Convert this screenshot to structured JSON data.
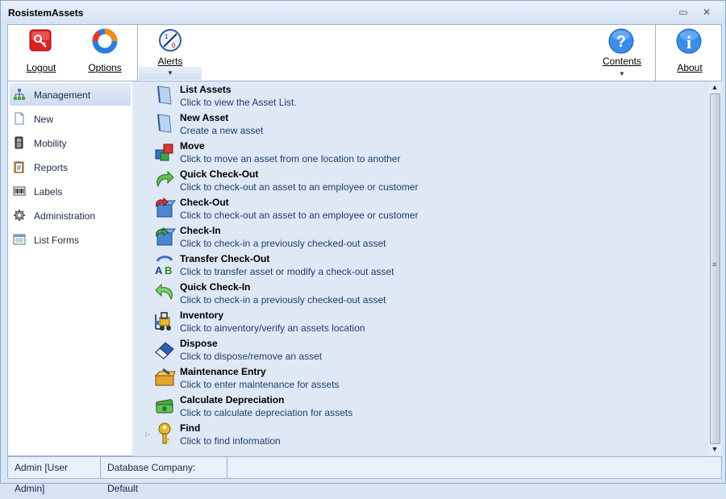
{
  "window": {
    "title": "RosistemAssets",
    "minimize_glyph": "▭",
    "close_glyph": "✕"
  },
  "ribbon": {
    "logout_label": "Logout",
    "options_label": "Options",
    "alerts_label": "Alerts",
    "contents_label": "Contents",
    "about_label": "About",
    "dropdown_glyph": "▼"
  },
  "sidebar": {
    "items": [
      {
        "label": "Management",
        "icon": "org-chart-icon",
        "selected": true
      },
      {
        "label": "New",
        "icon": "new-document-icon"
      },
      {
        "label": "Mobility",
        "icon": "handheld-scanner-icon"
      },
      {
        "label": "Reports",
        "icon": "clipboard-report-icon"
      },
      {
        "label": "Labels",
        "icon": "barcode-icon"
      },
      {
        "label": "Administration",
        "icon": "gear-icon"
      },
      {
        "label": "List Forms",
        "icon": "list-form-icon"
      }
    ]
  },
  "entries": [
    {
      "title": "List Assets",
      "desc": "Click to view the Asset List.",
      "icon": "document-icon"
    },
    {
      "title": "New Asset",
      "desc": "Create a new asset",
      "icon": "document-icon"
    },
    {
      "title": "Move",
      "desc": "Click to move an asset from one location to another",
      "icon": "move-boxes-icon"
    },
    {
      "title": "Quick Check-Out",
      "desc": "Click to check-out an asset to an employee or customer",
      "icon": "green-arrow-out-icon"
    },
    {
      "title": "Check-Out",
      "desc": "Click to check-out an asset to an employee or customer",
      "icon": "box-checkout-icon"
    },
    {
      "title": "Check-In",
      "desc": "Click to check-in a previously checked-out asset",
      "icon": "box-checkin-icon"
    },
    {
      "title": "Transfer Check-Out",
      "desc": "Click to transfer asset or modify a check-out asset",
      "icon": "ab-transfer-icon"
    },
    {
      "title": "Quick Check-In",
      "desc": "Click to check-in a previously checked-out asset",
      "icon": "green-arrow-in-icon"
    },
    {
      "title": "Inventory",
      "desc": "Click to ainventory/verify an assets location",
      "icon": "forklift-icon"
    },
    {
      "title": "Dispose",
      "desc": "Click to dispose/remove an asset",
      "icon": "eraser-icon"
    },
    {
      "title": "Maintenance Entry",
      "desc": "Click to enter maintenance for assets",
      "icon": "toolbox-icon"
    },
    {
      "title": "Calculate Depreciation",
      "desc": "Click to calculate depreciation for assets",
      "icon": "money-icon"
    },
    {
      "title": "Find",
      "desc": "Click to find information",
      "icon": "key-icon"
    }
  ],
  "scrollbar": {
    "up_glyph": "▲",
    "down_glyph": "▼",
    "grip_glyph": "≡"
  },
  "expander_glyph": "▷",
  "status": {
    "user": "Admin [User Admin]",
    "company": "Database Company: Default"
  },
  "colors": {
    "accent": "#9db3d2",
    "content_bg": "#dfe8f5"
  }
}
